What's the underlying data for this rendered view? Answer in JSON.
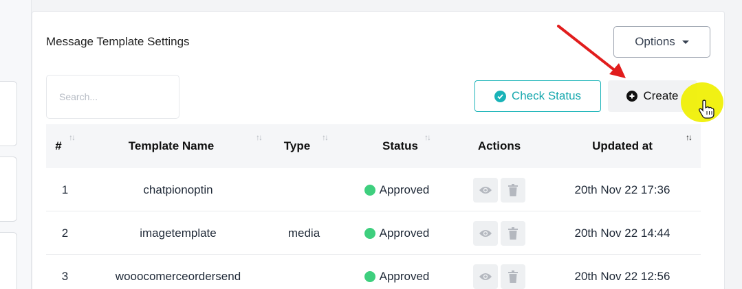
{
  "page": {
    "title": "Message Template Settings"
  },
  "toolbar": {
    "options_label": "Options",
    "search_placeholder": "Search...",
    "check_status_label": "Check Status",
    "create_label": "Create"
  },
  "table": {
    "columns": [
      "#",
      "Template Name",
      "Type",
      "Status",
      "Actions",
      "Updated at"
    ],
    "rows": [
      {
        "num": "1",
        "name": "chatpionoptin",
        "type": "",
        "status": "Approved",
        "updated": "20th Nov 22 17:36"
      },
      {
        "num": "2",
        "name": "imagetemplate",
        "type": "media",
        "status": "Approved",
        "updated": "20th Nov 22 14:44"
      },
      {
        "num": "3",
        "name": "wooocomerceordersend",
        "type": "",
        "status": "Approved",
        "updated": "20th Nov 22 12:56"
      }
    ]
  },
  "colors": {
    "accent": "#19b3b8",
    "approved": "#3ecf7e",
    "arrow": "#e11d1d",
    "highlight": "#f0f000"
  },
  "icons": [
    "check-circle-icon",
    "plus-circle-icon",
    "eye-icon",
    "trash-icon",
    "sort-icon",
    "caret-down-icon",
    "hand-cursor-icon"
  ]
}
